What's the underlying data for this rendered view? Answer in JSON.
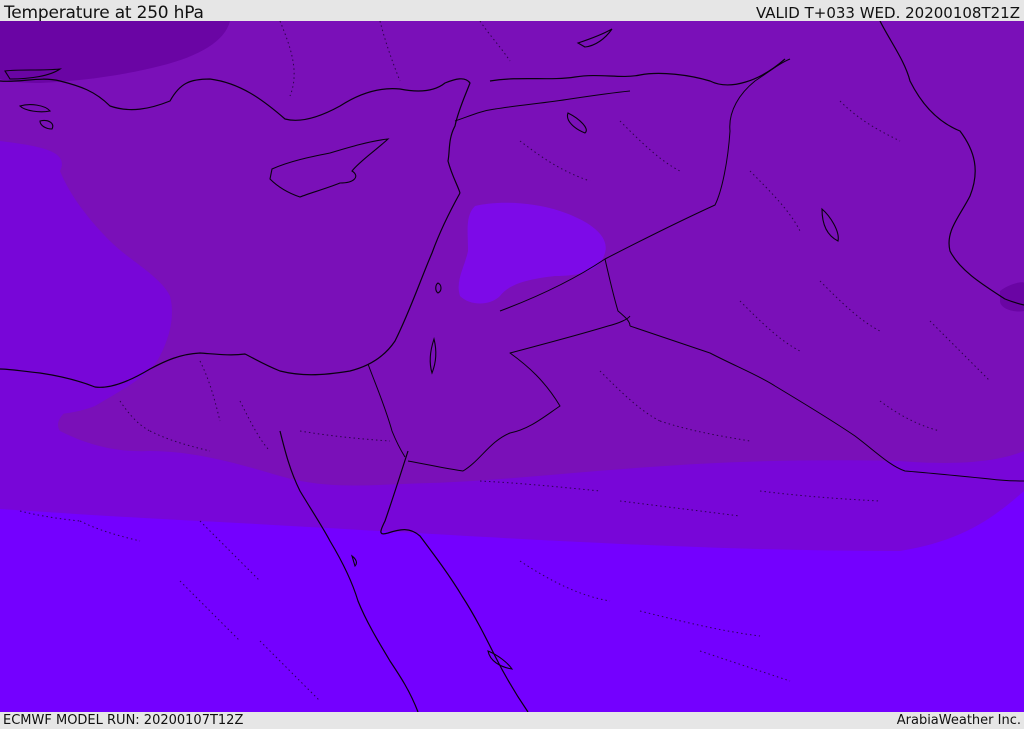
{
  "header": {
    "title": "Temperature at 250 hPa",
    "valid": "VALID T+033 WED. 20200108T21Z"
  },
  "footer": {
    "model_run": "ECMWF MODEL RUN: 20200107T12Z",
    "credit": "ArabiaWeather Inc."
  },
  "map": {
    "colors": {
      "band_north": "#7a10b8",
      "band_mid": "#7806d8",
      "band_south": "#7400ff",
      "cold_pocket": "#6a05a4",
      "warm_pocket": "#7d0ae8",
      "outline": "#0a0010"
    }
  }
}
